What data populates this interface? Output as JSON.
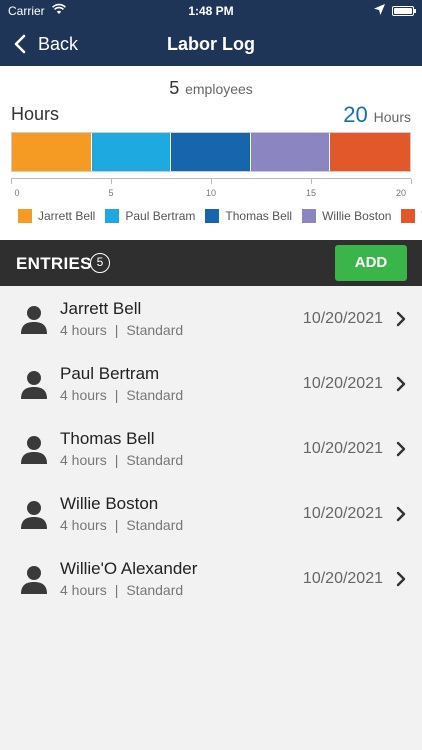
{
  "status_bar": {
    "carrier": "Carrier",
    "time": "1:48 PM"
  },
  "nav": {
    "back_label": "Back",
    "title": "Labor Log"
  },
  "summary": {
    "employee_count": "5",
    "employee_label": "employees",
    "hours_label": "Hours",
    "total_hours": "20",
    "total_hours_unit": "Hours"
  },
  "chart_data": {
    "type": "bar",
    "orientation": "horizontal-stacked",
    "categories": [
      "Jarrett Bell",
      "Paul Bertram",
      "Thomas Bell",
      "Willie Boston",
      "Willie'O Alexander"
    ],
    "values": [
      4,
      4,
      4,
      4,
      4
    ],
    "colors": [
      "#f59a23",
      "#1fa9e1",
      "#1766ad",
      "#8b86c1",
      "#e2582a"
    ],
    "xlim": [
      0,
      20
    ],
    "ticks": [
      "0",
      "5",
      "10",
      "15",
      "20"
    ],
    "legend_labels": [
      "Jarrett Bell",
      "Paul Bertram",
      "Thomas Bell",
      "Willie Boston",
      "W"
    ],
    "legend_position": "bottom"
  },
  "entries_header": {
    "title": "ENTRIES",
    "count": "5",
    "add_label": "ADD"
  },
  "entries": [
    {
      "name": "Jarrett Bell",
      "hours": "4 hours",
      "sep": "|",
      "type": "Standard",
      "date": "10/20/2021"
    },
    {
      "name": "Paul Bertram",
      "hours": "4 hours",
      "sep": "|",
      "type": "Standard",
      "date": "10/20/2021"
    },
    {
      "name": "Thomas Bell",
      "hours": "4 hours",
      "sep": "|",
      "type": "Standard",
      "date": "10/20/2021"
    },
    {
      "name": "Willie Boston",
      "hours": "4 hours",
      "sep": "|",
      "type": "Standard",
      "date": "10/20/2021"
    },
    {
      "name": "Willie'O Alexander",
      "hours": "4 hours",
      "sep": "|",
      "type": "Standard",
      "date": "10/20/2021"
    }
  ]
}
